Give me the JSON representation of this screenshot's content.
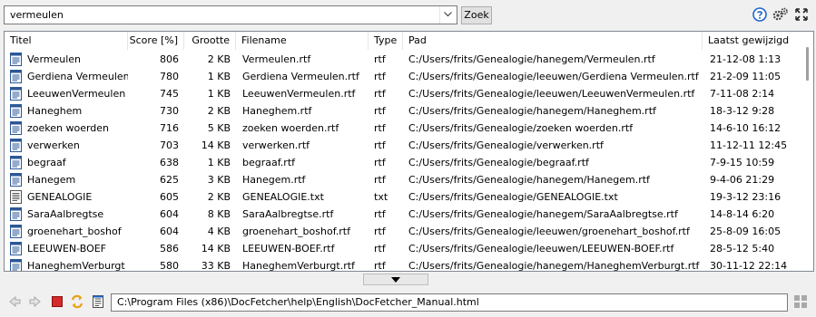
{
  "search": {
    "query": "vermeulen",
    "button_label": "Zoek"
  },
  "table": {
    "columns": [
      "Titel",
      "Score [%]",
      "Grootte",
      "Filename",
      "Type",
      "Pad",
      "Laatst gewijzigd"
    ],
    "rows": [
      [
        "Vermeulen",
        "806",
        "2 KB",
        "Vermeulen.rtf",
        "rtf",
        "C:/Users/frits/Genealogie/hanegem/Vermeulen.rtf",
        "21-12-08 1:13"
      ],
      [
        "Gerdiena Vermeulen",
        "780",
        "1 KB",
        "Gerdiena Vermeulen.rtf",
        "rtf",
        "C:/Users/frits/Genealogie/leeuwen/Gerdiena Vermeulen.rtf",
        "21-2-09 11:05"
      ],
      [
        "LeeuwenVermeulen",
        "745",
        "1 KB",
        "LeeuwenVermeulen.rtf",
        "rtf",
        "C:/Users/frits/Genealogie/leeuwen/LeeuwenVermeulen.rtf",
        "7-11-08 2:14"
      ],
      [
        "Haneghem",
        "730",
        "2 KB",
        "Haneghem.rtf",
        "rtf",
        "C:/Users/frits/Genealogie/hanegem/Haneghem.rtf",
        "18-3-12 9:28"
      ],
      [
        "zoeken woerden",
        "716",
        "5 KB",
        "zoeken woerden.rtf",
        "rtf",
        "C:/Users/frits/Genealogie/zoeken woerden.rtf",
        "14-6-10 16:12"
      ],
      [
        "verwerken",
        "703",
        "14 KB",
        "verwerken.rtf",
        "rtf",
        "C:/Users/frits/Genealogie/verwerken.rtf",
        "11-12-11 12:45"
      ],
      [
        "begraaf",
        "638",
        "1 KB",
        "begraaf.rtf",
        "rtf",
        "C:/Users/frits/Genealogie/begraaf.rtf",
        "7-9-15 10:59"
      ],
      [
        "Hanegem",
        "625",
        "3 KB",
        "Hanegem.rtf",
        "rtf",
        "C:/Users/frits/Genealogie/hanegem/Hanegem.rtf",
        "9-4-06 21:29"
      ],
      [
        "GENEALOGIE",
        "605",
        "2 KB",
        "GENEALOGIE.txt",
        "txt",
        "C:/Users/frits/Genealogie/GENEALOGIE.txt",
        "19-3-12 23:16"
      ],
      [
        "SaraAalbregtse",
        "604",
        "8 KB",
        "SaraAalbregtse.rtf",
        "rtf",
        "C:/Users/frits/Genealogie/hanegem/SaraAalbregtse.rtf",
        "14-8-14 6:20"
      ],
      [
        "groenehart_boshof",
        "604",
        "4 KB",
        "groenehart_boshof.rtf",
        "rtf",
        "C:/Users/frits/Genealogie/leeuwen/groenehart_boshof.rtf",
        "25-8-09 16:05"
      ],
      [
        "LEEUWEN-BOEF",
        "586",
        "14 KB",
        "LEEUWEN-BOEF.rtf",
        "rtf",
        "C:/Users/frits/Genealogie/leeuwen/LEEUWEN-BOEF.rtf",
        "28-5-12 5:40"
      ],
      [
        "HaneghemVerburgt",
        "580",
        "33 KB",
        "HaneghemVerburgt.rtf",
        "rtf",
        "C:/Users/frits/Genealogie/hanegem/HaneghemVerburgt.rtf",
        "30-11-12 22:14"
      ]
    ]
  },
  "preview": {
    "location": "C:\\Program Files (x86)\\DocFetcher\\help\\English\\DocFetcher_Manual.html"
  },
  "icons": {
    "help": "help-icon",
    "preferences": "preferences-icon",
    "maximize": "maximize-icon",
    "back": "back-icon",
    "forward": "forward-icon",
    "stop": "stop-icon",
    "reload": "reload-icon",
    "open_file": "open-file-icon",
    "split": "split-view-icon"
  },
  "colors": {
    "accent": "#1e64c8",
    "stop": "#d42a2a",
    "reload": "#e8a317"
  }
}
